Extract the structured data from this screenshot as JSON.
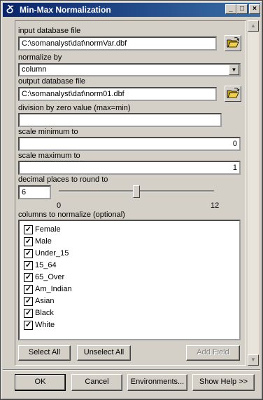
{
  "window": {
    "title": "Min-Max Normalization",
    "controls": {
      "minimize": "_",
      "maximize": "□",
      "close": "×"
    }
  },
  "form": {
    "input_db": {
      "label": "input database file",
      "value": "C:\\somanalyst\\dat\\normVar.dbf"
    },
    "normalize_by": {
      "label": "normalize by",
      "value": "column"
    },
    "output_db": {
      "label": "output database file",
      "value": "C:\\somanalyst\\dat\\norm01.dbf"
    },
    "div_zero": {
      "label": "division by zero value (max=min)",
      "value": ""
    },
    "scale_min": {
      "label": "scale minimum to",
      "value": "0"
    },
    "scale_max": {
      "label": "scale maximum to",
      "value": "1"
    },
    "decimal": {
      "label": "decimal places to round to",
      "value": "6",
      "slider_min": "0",
      "slider_max": "12",
      "slider_value": 6
    },
    "columns": {
      "label": "columns to normalize (optional)",
      "items": [
        {
          "name": "Female",
          "checked": true
        },
        {
          "name": "Male",
          "checked": true
        },
        {
          "name": "Under_15",
          "checked": true
        },
        {
          "name": "15_64",
          "checked": true
        },
        {
          "name": "65_Over",
          "checked": true
        },
        {
          "name": "Am_Indian",
          "checked": true
        },
        {
          "name": "Asian",
          "checked": true
        },
        {
          "name": "Black",
          "checked": true
        },
        {
          "name": "White",
          "checked": true
        }
      ]
    },
    "buttons": {
      "select_all": "Select All",
      "unselect_all": "Unselect All",
      "add_field": "Add Field"
    }
  },
  "footer": {
    "ok": "OK",
    "cancel": "Cancel",
    "environments": "Environments...",
    "show_help": "Show Help >>"
  },
  "colors": {
    "title_start": "#0a246a",
    "title_end": "#3a6ea5",
    "face": "#d4d0c8"
  },
  "icons": {
    "app": "scroll-icon",
    "browse": "open-folder-icon",
    "check": "check-icon"
  }
}
